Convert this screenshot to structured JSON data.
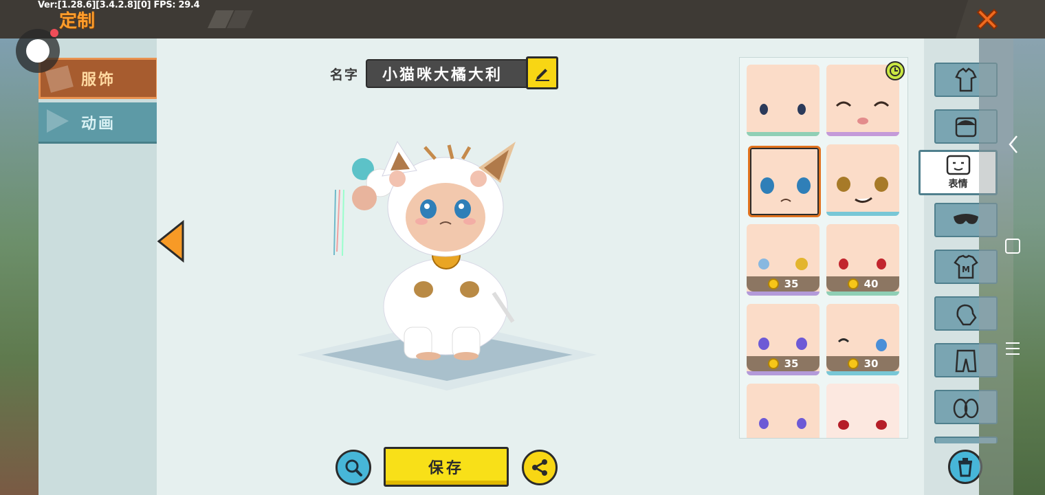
{
  "debug": {
    "text": "Ver:[1.28.6][3.4.2.8][0] FPS: 29.4"
  },
  "header": {
    "title": "定制"
  },
  "categories": [
    {
      "label": "服饰",
      "active": true
    },
    {
      "label": "动画",
      "active": false
    }
  ],
  "name": {
    "label": "名字",
    "value": "小猫咪大橘大利"
  },
  "actions": {
    "save_label": "保存"
  },
  "faces": [
    {
      "price": null,
      "selected": false
    },
    {
      "price": null,
      "selected": false,
      "timed": true
    },
    {
      "price": null,
      "selected": true
    },
    {
      "price": null,
      "selected": false
    },
    {
      "price": "35",
      "selected": false
    },
    {
      "price": "40",
      "selected": false
    },
    {
      "price": "35",
      "selected": false
    },
    {
      "price": "30",
      "selected": false
    },
    {
      "price": null,
      "selected": false
    },
    {
      "price": null,
      "selected": false
    }
  ],
  "tabs": [
    {
      "icon": "outfit-icon"
    },
    {
      "icon": "hair-icon"
    },
    {
      "icon": "face-icon",
      "label": "表情",
      "selected": true
    },
    {
      "icon": "mask-icon"
    },
    {
      "icon": "shirt-icon"
    },
    {
      "icon": "gloves-icon"
    },
    {
      "icon": "pants-icon"
    },
    {
      "icon": "shoes-icon"
    }
  ],
  "colors": {
    "accent_orange": "#a75c2f",
    "title_orange": "#ff9d2b",
    "button_yellow": "#f8d614",
    "button_blue": "#47b6d8"
  }
}
